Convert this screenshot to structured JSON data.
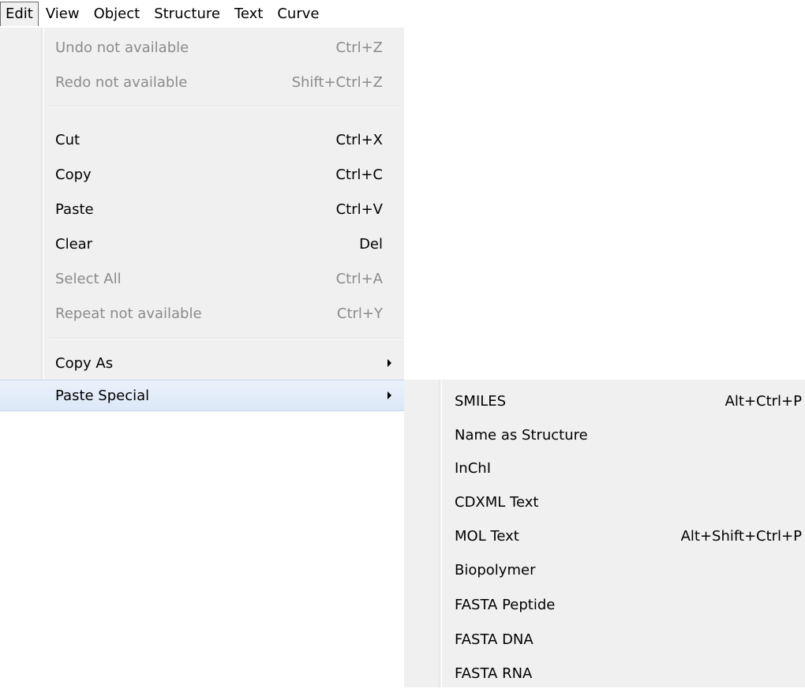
{
  "menubar": {
    "items": [
      "Edit",
      "View",
      "Object",
      "Structure",
      "Text",
      "Curve"
    ]
  },
  "edit_menu": {
    "items": [
      {
        "label": "Undo not available",
        "shortcut": "Ctrl+Z"
      },
      {
        "label": "Redo not available",
        "shortcut": "Shift+Ctrl+Z"
      },
      {
        "label": "Cut",
        "shortcut": "Ctrl+X"
      },
      {
        "label": "Copy",
        "shortcut": "Ctrl+C"
      },
      {
        "label": "Paste",
        "shortcut": "Ctrl+V"
      },
      {
        "label": "Clear",
        "shortcut": "Del"
      },
      {
        "label": "Select All",
        "shortcut": "Ctrl+A"
      },
      {
        "label": "Repeat not available",
        "shortcut": "Ctrl+Y"
      },
      {
        "label": "Copy As"
      },
      {
        "label": "Paste Special"
      }
    ]
  },
  "paste_special_menu": {
    "items": [
      {
        "label": "SMILES",
        "shortcut": "Alt+Ctrl+P"
      },
      {
        "label": "Name as Structure"
      },
      {
        "label": "InChI"
      },
      {
        "label": "CDXML Text"
      },
      {
        "label": "MOL Text",
        "shortcut": "Alt+Shift+Ctrl+P"
      },
      {
        "label": "Biopolymer"
      },
      {
        "label": "FASTA Peptide"
      },
      {
        "label": "FASTA DNA"
      },
      {
        "label": "FASTA RNA"
      }
    ]
  },
  "colors": {
    "menu_bg": "#f0f0f0",
    "disabled_text": "#8b8b8b",
    "highlight_bg": "#dce8f7",
    "highlight_border": "#c3d5ee"
  }
}
